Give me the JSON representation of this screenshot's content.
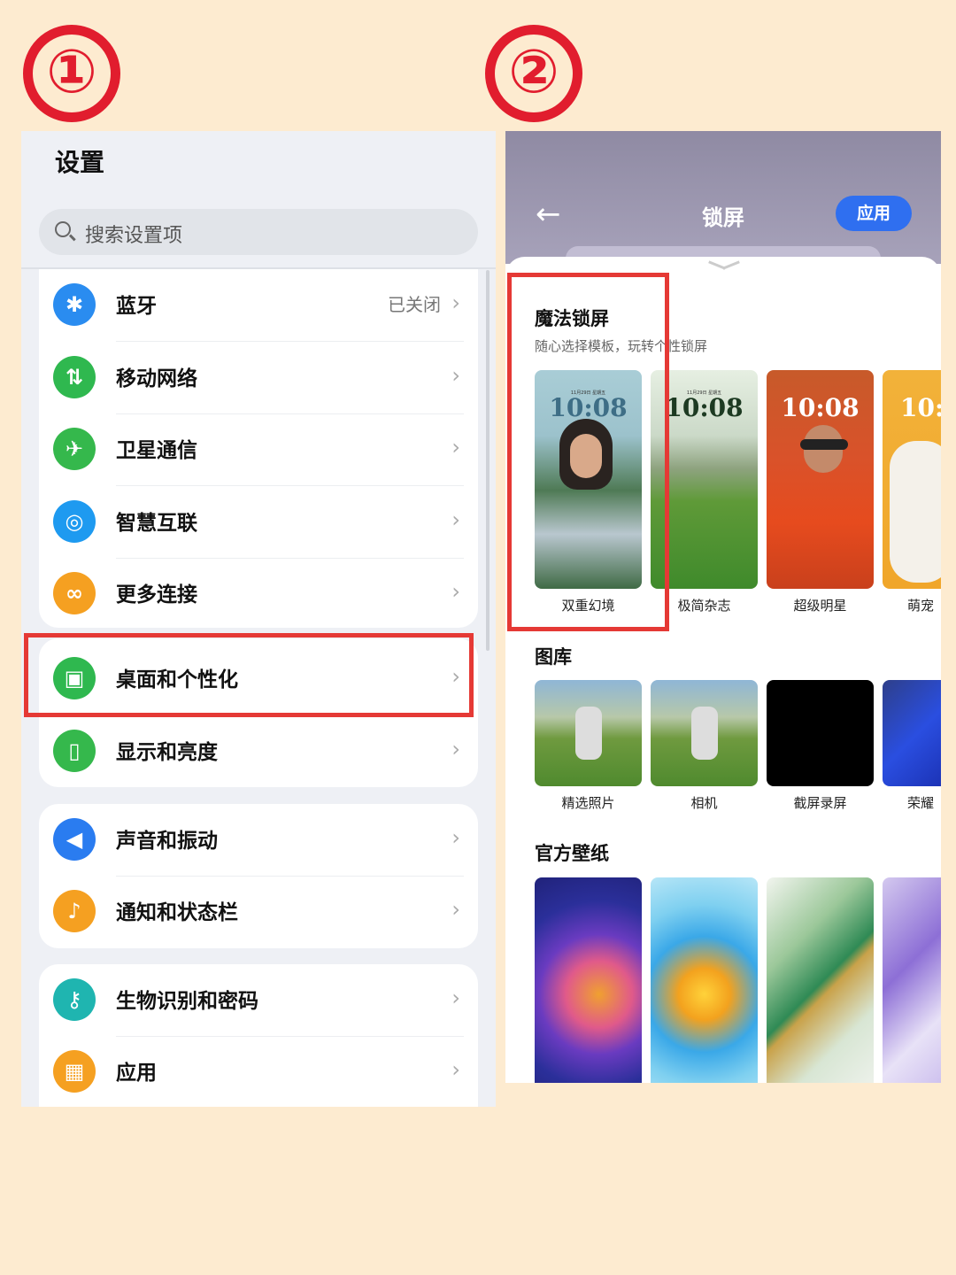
{
  "steps": [
    "①",
    "②"
  ],
  "settings": {
    "title": "设置",
    "search_placeholder": "搜索设置项",
    "groups": [
      [
        {
          "label": "蓝牙",
          "status": "已关闭",
          "icon": "bluetooth-icon",
          "color": "#2a8cf0"
        },
        {
          "label": "移动网络",
          "status": "",
          "icon": "mobile-network-icon",
          "color": "#2fb84f"
        },
        {
          "label": "卫星通信",
          "status": "",
          "icon": "satellite-icon",
          "color": "#35b84c"
        },
        {
          "label": "智慧互联",
          "status": "",
          "icon": "smart-connect-icon",
          "color": "#1e9af0"
        },
        {
          "label": "更多连接",
          "status": "",
          "icon": "link-icon",
          "color": "#f5a021"
        }
      ],
      [
        {
          "label": "桌面和个性化",
          "status": "",
          "icon": "wallpaper-icon",
          "color": "#2fb84f"
        },
        {
          "label": "显示和亮度",
          "status": "",
          "icon": "display-icon",
          "color": "#35b84c"
        }
      ],
      [
        {
          "label": "声音和振动",
          "status": "",
          "icon": "sound-icon",
          "color": "#2a7cf0"
        },
        {
          "label": "通知和状态栏",
          "status": "",
          "icon": "bell-icon",
          "color": "#f5a021"
        }
      ],
      [
        {
          "label": "生物识别和密码",
          "status": "",
          "icon": "key-icon",
          "color": "#1fb5b0"
        },
        {
          "label": "应用",
          "status": "",
          "icon": "apps-icon",
          "color": "#f5a021"
        }
      ]
    ]
  },
  "lockscreen": {
    "title": "锁屏",
    "back_icon": "back-arrow-icon",
    "apply_label": "应用",
    "magic": {
      "title": "魔法锁屏",
      "subtitle": "随心选择模板，玩转个性锁屏",
      "items": [
        {
          "label": "双重幻境",
          "clock": "10:08"
        },
        {
          "label": "极简杂志",
          "clock": "10:08"
        },
        {
          "label": "超级明星",
          "clock": "10:08"
        },
        {
          "label": "萌宠",
          "clock": "10:"
        }
      ]
    },
    "gallery": {
      "title": "图库",
      "items": [
        "精选照片",
        "相机",
        "截屏录屏",
        "荣耀"
      ]
    },
    "official": {
      "title": "官方壁纸"
    }
  }
}
